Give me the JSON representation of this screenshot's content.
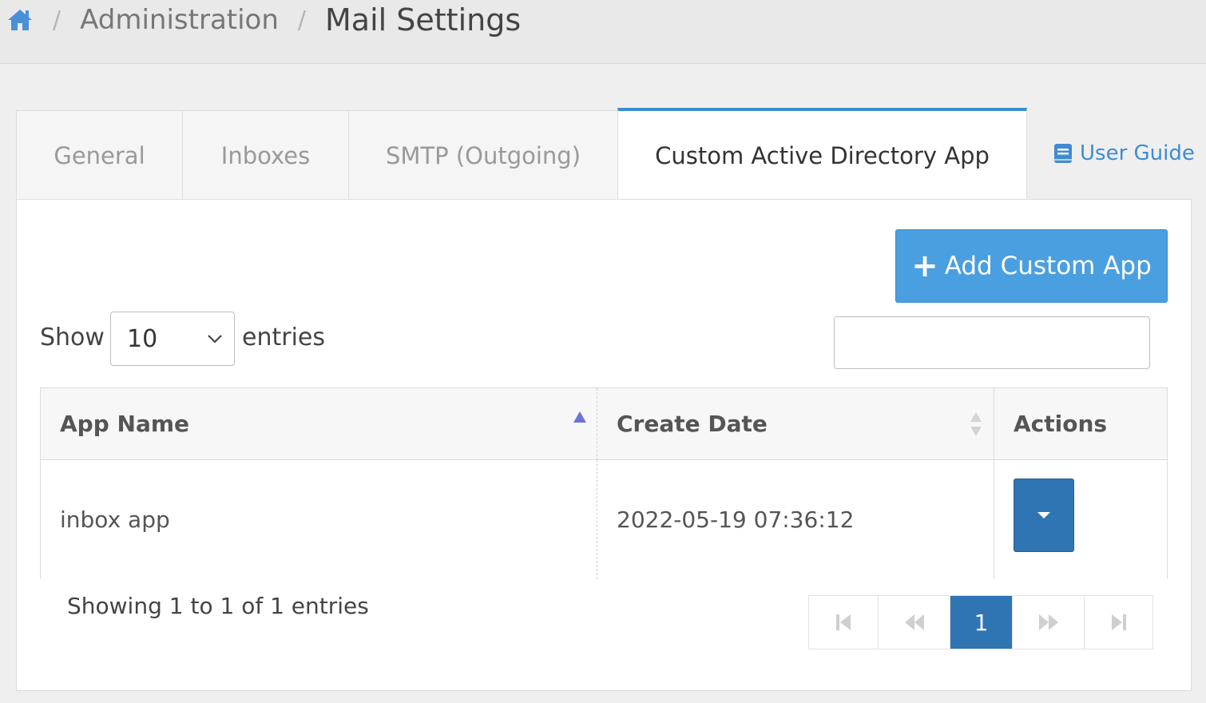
{
  "breadcrumb": {
    "home_icon": "home-icon",
    "separator": "/",
    "items": [
      "Administration",
      "Mail Settings"
    ]
  },
  "tabs": [
    {
      "label": "General",
      "active": false
    },
    {
      "label": "Inboxes",
      "active": false
    },
    {
      "label": "SMTP (Outgoing)",
      "active": false
    },
    {
      "label": "Custom Active Directory App",
      "active": true
    }
  ],
  "user_guide": {
    "label": "User Guide",
    "icon": "book-icon"
  },
  "toolbar": {
    "add_label": "Add Custom App",
    "add_icon": "plus-icon"
  },
  "length_menu": {
    "show_label": "Show",
    "selected": "10",
    "entries_label": "entries"
  },
  "search": {
    "value": "",
    "placeholder": ""
  },
  "table": {
    "columns": [
      "App Name",
      "Create Date",
      "Actions"
    ],
    "sort": {
      "column": "App Name",
      "direction": "ascending"
    },
    "rows": [
      {
        "app_name": "inbox app",
        "create_date": "2022-05-19 07:36:12"
      }
    ]
  },
  "info": "Showing 1 to 1 of 1 entries",
  "pagination": {
    "current_page": "1",
    "buttons": [
      "first-page-icon",
      "previous-page-icon",
      "1",
      "next-page-icon",
      "last-page-icon"
    ]
  },
  "colors": {
    "accent": "#3c8dd0",
    "add_button": "#4a9fe0",
    "action_button": "#2f74b3",
    "sort_indicator": "#6b74d6"
  }
}
